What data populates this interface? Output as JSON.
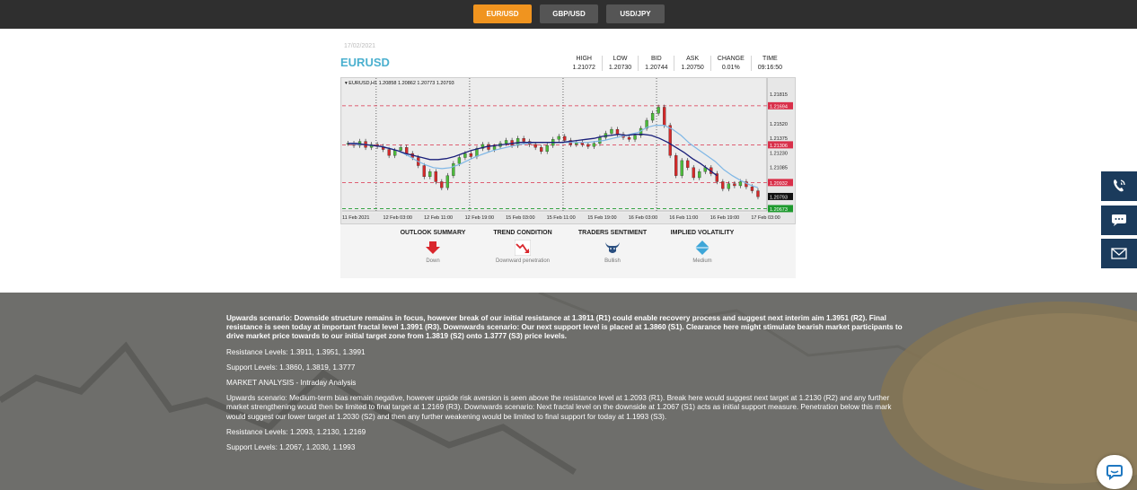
{
  "tabs": [
    {
      "label": "EUR/USD",
      "active": true
    },
    {
      "label": "GBP/USD",
      "active": false
    },
    {
      "label": "USD/JPY",
      "active": false
    }
  ],
  "widget": {
    "date": "17/02/2021",
    "symbol": "EURUSD",
    "quotes": [
      {
        "label": "HIGH",
        "value": "1.21072"
      },
      {
        "label": "LOW",
        "value": "1.20730"
      },
      {
        "label": "BID",
        "value": "1.20744"
      },
      {
        "label": "ASK",
        "value": "1.20750"
      },
      {
        "label": "CHANGE",
        "value": "0.01%"
      },
      {
        "label": "TIME",
        "value": "09:16:50"
      }
    ],
    "indicators": [
      {
        "title": "OUTLOOK SUMMARY",
        "value": "Down",
        "icon": "red-down-arrow-icon"
      },
      {
        "title": "TREND CONDITION",
        "value": "Downward penetration",
        "icon": "downtrend-chart-icon"
      },
      {
        "title": "TRADERS SENTIMENT",
        "value": "Bullish",
        "icon": "bull-icon"
      },
      {
        "title": "IMPLIED VOLATILITY",
        "value": "Medium",
        "icon": "blue-diamond-icon"
      }
    ]
  },
  "chart_data": {
    "type": "candlestick",
    "header": "EURUSD,H1  1.20858 1.20862 1.20773 1.20793",
    "x_ticks": [
      "11 Feb 2021",
      "12 Feb 03:00",
      "12 Feb 11:00",
      "12 Feb 19:00",
      "15 Feb 03:00",
      "15 Feb 11:00",
      "15 Feb 19:00",
      "16 Feb 03:00",
      "16 Feb 11:00",
      "16 Feb 19:00",
      "17 Feb 03:00"
    ],
    "y_ticks": [
      "1.21815",
      "1.21520",
      "1.21375",
      "1.21230",
      "1.21085",
      "1.20793"
    ],
    "ylim": [
      1.2065,
      1.2188
    ],
    "levels": [
      {
        "label": "1.21694",
        "value": 1.21694,
        "color": "#d9304a"
      },
      {
        "label": "1.21306",
        "value": 1.21306,
        "color": "#d9304a"
      },
      {
        "label": "1.20932",
        "value": 1.20932,
        "color": "#d9304a"
      },
      {
        "label": "1.20673",
        "value": 1.20673,
        "color": "#1e9a2e"
      }
    ],
    "current_price": "1.20793",
    "closes": [
      1.2132,
      1.213,
      1.2134,
      1.2128,
      1.2131,
      1.2129,
      1.2126,
      1.212,
      1.2125,
      1.2128,
      1.2122,
      1.2118,
      1.211,
      1.2099,
      1.2104,
      1.2094,
      1.2088,
      1.21,
      1.2112,
      1.2118,
      1.2122,
      1.2119,
      1.2127,
      1.2131,
      1.2126,
      1.2129,
      1.2132,
      1.2135,
      1.213,
      1.2137,
      1.2134,
      1.2131,
      1.2128,
      1.2124,
      1.213,
      1.2136,
      1.2139,
      1.2135,
      1.2131,
      1.2133,
      1.2131,
      1.2129,
      1.2132,
      1.2138,
      1.2142,
      1.2146,
      1.2141,
      1.2138,
      1.2136,
      1.214,
      1.2147,
      1.2155,
      1.2162,
      1.2168,
      1.215,
      1.212,
      1.21,
      1.2115,
      1.2108,
      1.2098,
      1.2104,
      1.2108,
      1.2102,
      1.2094,
      1.2087,
      1.2092,
      1.209,
      1.2094,
      1.2089,
      1.2085,
      1.2079
    ],
    "ma_fast": [
      1.2132,
      1.2131,
      1.2131,
      1.213,
      1.2129,
      1.2127,
      1.2124,
      1.212,
      1.2115,
      1.2111,
      1.2108,
      1.2107,
      1.2108,
      1.2111,
      1.2115,
      1.2119,
      1.2122,
      1.2125,
      1.2127,
      1.2129,
      1.2131,
      1.2132,
      1.2133,
      1.2133,
      1.2133,
      1.2133,
      1.2133,
      1.2133,
      1.2133,
      1.2134,
      1.2135,
      1.2137,
      1.2139,
      1.2141,
      1.2143,
      1.2148,
      1.215,
      1.215,
      1.2146,
      1.214,
      1.2132,
      1.2126,
      1.212,
      1.2114,
      1.2106,
      1.21,
      1.2095,
      1.2091,
      1.2088
    ],
    "ma_slow": [
      1.2132,
      1.2132,
      1.2131,
      1.213,
      1.2129,
      1.2127,
      1.2125,
      1.2122,
      1.212,
      1.2118,
      1.2116,
      1.2116,
      1.2117,
      1.2119,
      1.2122,
      1.2125,
      1.2127,
      1.2129,
      1.213,
      1.2131,
      1.2132,
      1.2133,
      1.2133,
      1.2133,
      1.2133,
      1.2133,
      1.2133,
      1.2134,
      1.2135,
      1.2136,
      1.2137,
      1.2139,
      1.214,
      1.2141,
      1.214,
      1.2141,
      1.2141,
      1.214,
      1.2137,
      1.2133,
      1.2128,
      1.2123,
      1.2117,
      1.2112,
      1.2106,
      1.21
    ]
  },
  "analysis": {
    "p1": "Upwards scenario: Downside structure remains in focus, however break of our initial resistance at 1.3911 (R1) could enable recovery process and suggest next interim aim 1.3951 (R2). Final resistance is seen today at important fractal level 1.3991 (R3). Downwards scenario: Our next support level is placed at 1.3860 (S1). Clearance here might stimulate bearish market participants to drive market price towards to our initial target zone from 1.3819 (S2) onto 1.3777 (S3) price levels.",
    "p2": "Resistance Levels: 1.3911, 1.3951, 1.3991",
    "p3": "Support Levels: 1.3860, 1.3819, 1.3777",
    "p4": "MARKET ANALYSIS - Intraday Analysis",
    "p5": "Upwards scenario: Medium-term bias remain negative, however upside risk aversion is seen above the resistance level at 1.2093 (R1). Break here would suggest next target at 1.2130 (R2) and any further market strengthening would then be limited to final target at 1.2169 (R3). Downwards scenario: Next fractal level on the downside at 1.2067 (S1) acts as initial support measure. Penetration below this mark would suggest our lower target at 1.2030 (S2) and then any further weakening would be limited to final support for today at 1.1993 (S3).",
    "p6": "Resistance Levels: 1.2093, 1.2130, 1.2169",
    "p7": "Support Levels: 1.2067, 1.2030, 1.1993"
  },
  "side_buttons": [
    {
      "icon": "phone-icon"
    },
    {
      "icon": "chat-icon"
    },
    {
      "icon": "mail-icon"
    }
  ],
  "colors": {
    "accent": "#f0941f",
    "symbol": "#4bb0cf",
    "side_button": "#1b3b5c",
    "bull_candle": "#4cbb3a",
    "bear_candle": "#d42a2a"
  }
}
